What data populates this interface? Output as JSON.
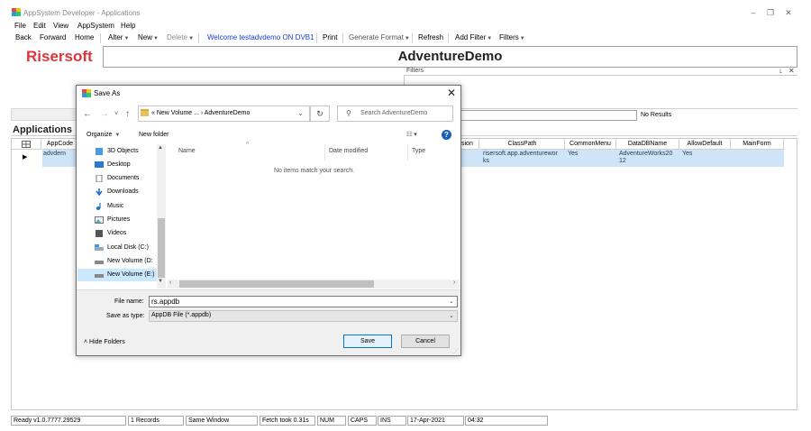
{
  "window": {
    "title": "AppSystem Developer - Applications",
    "controls": {
      "minimize": "–",
      "restore": "❐",
      "close": "✕"
    }
  },
  "menu": [
    "File",
    "Edit",
    "View",
    "AppSystem",
    "Help"
  ],
  "toolbar": {
    "back": "Back",
    "forward": "Forward",
    "home": "Home",
    "alter": "Alter",
    "new": "New",
    "delete": "Delete",
    "welcome": "Welcome testadvdemo ON DVB1",
    "print": "Print",
    "generate_format": "Generate Format",
    "refresh": "Refresh",
    "add_filter": "Add Filter",
    "filters": "Filters",
    "welcome_color": "#1a3fd6"
  },
  "header": {
    "logo": "Risersoft",
    "title": "AdventureDemo",
    "brand_color": "#d9363e"
  },
  "filters_pane": {
    "label": "Filters",
    "pin": "꜖",
    "close": "✕"
  },
  "results": {
    "status": "No Results"
  },
  "applications": {
    "title": "Applications",
    "columns": [
      "AppCode",
      "sion",
      "ClassPath",
      "CommonMenu",
      "DataDBName",
      "AllowDefault",
      "MainForm"
    ],
    "rows": [
      {
        "AppCode": "advdem",
        "ClassPath": "risersoft.app.adventurewor\nks",
        "CommonMenu": "Yes",
        "DataDBName": "AdventureWorks20\n12",
        "AllowDefault": "Yes",
        "MainForm": ""
      }
    ],
    "selection_color": "#cfe4f7"
  },
  "statusbar": {
    "ready": "Ready v1.0.7777.29529",
    "records": "1 Records",
    "window_mode": "Same Window",
    "fetch": "Fetch took 0.31s",
    "num": "NUM",
    "caps": "CAPS",
    "ins": "INS",
    "date": "17-Apr-2021",
    "time": "04:32"
  },
  "dialog": {
    "title": "Save As",
    "breadcrumb": "« New Volume ...  ›  AdventureDemo",
    "search_placeholder": "Search AdventureDemo",
    "organize": "Organize",
    "new_folder": "New folder",
    "nav_items": [
      "3D Objects",
      "Desktop",
      "Documents",
      "Downloads",
      "Music",
      "Pictures",
      "Videos",
      "Local Disk (C:)",
      "New Volume (D:",
      "New Volume (E:)"
    ],
    "columns": [
      "Name",
      "Date modified",
      "Type"
    ],
    "empty_message": "No items match your search.",
    "file_name_label": "File name:",
    "file_name": "rs.appdb",
    "save_type_label": "Save as type:",
    "save_type": "AppDB File (*.appdb)",
    "hide_folders": "Hide Folders",
    "save": "Save",
    "cancel": "Cancel",
    "help": "?"
  }
}
